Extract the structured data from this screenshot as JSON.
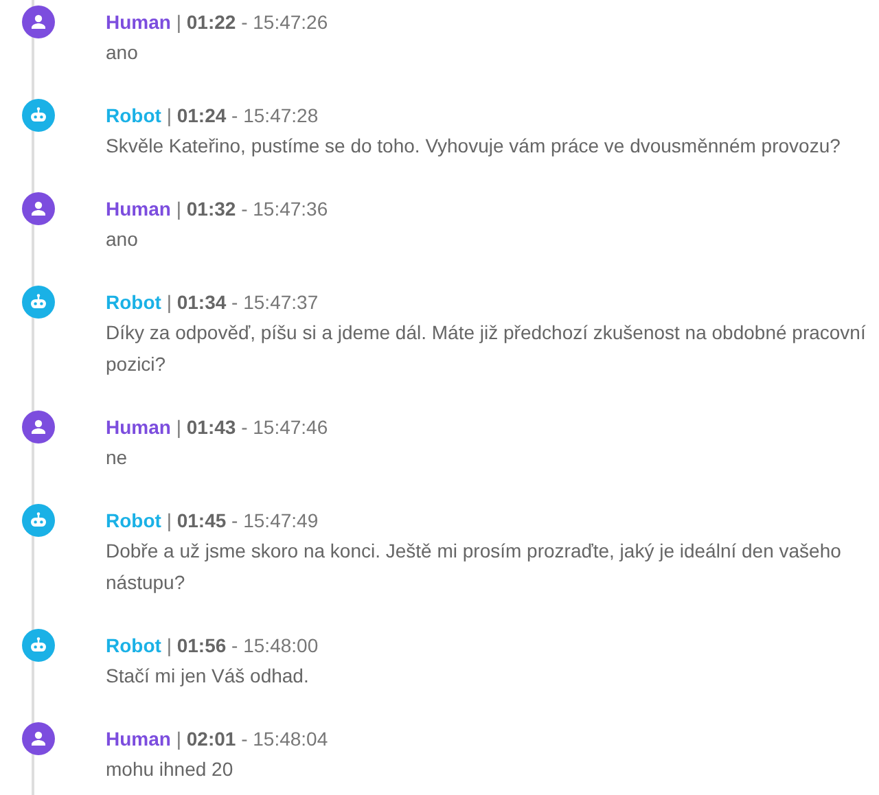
{
  "messages": [
    {
      "kind": "human",
      "speaker": "Human",
      "meta": "| **01:22** - 15:47:26",
      "text": "ano"
    },
    {
      "kind": "robot",
      "speaker": "Robot",
      "meta": "| **01:24** - 15:47:28",
      "text": "Skvěle Kateřino, pustíme se do toho. Vyhovuje vám práce ve dvousměnném provozu?"
    },
    {
      "kind": "human",
      "speaker": "Human",
      "meta": "| **01:32** - 15:47:36",
      "text": "ano"
    },
    {
      "kind": "robot",
      "speaker": "Robot",
      "meta": "| **01:34** - 15:47:37",
      "text": "Díky za odpověď, píšu si a jdeme dál. Máte již předchozí zkušenost na obdobné pracovní pozici?"
    },
    {
      "kind": "human",
      "speaker": "Human",
      "meta": "| **01:43** - 15:47:46",
      "text": "ne"
    },
    {
      "kind": "robot",
      "speaker": "Robot",
      "meta": "| **01:45** - 15:47:49",
      "text": "Dobře a už jsme skoro na konci. Ještě mi prosím prozraďte, jaký je ideální den vašeho nástupu?"
    },
    {
      "kind": "robot",
      "speaker": "Robot",
      "meta": "| **01:56** - 15:48:00",
      "text": "Stačí mi jen Váš odhad."
    },
    {
      "kind": "human",
      "speaker": "Human",
      "meta": "| **02:01** - 15:48:04",
      "text": "mohu ihned 20"
    }
  ]
}
